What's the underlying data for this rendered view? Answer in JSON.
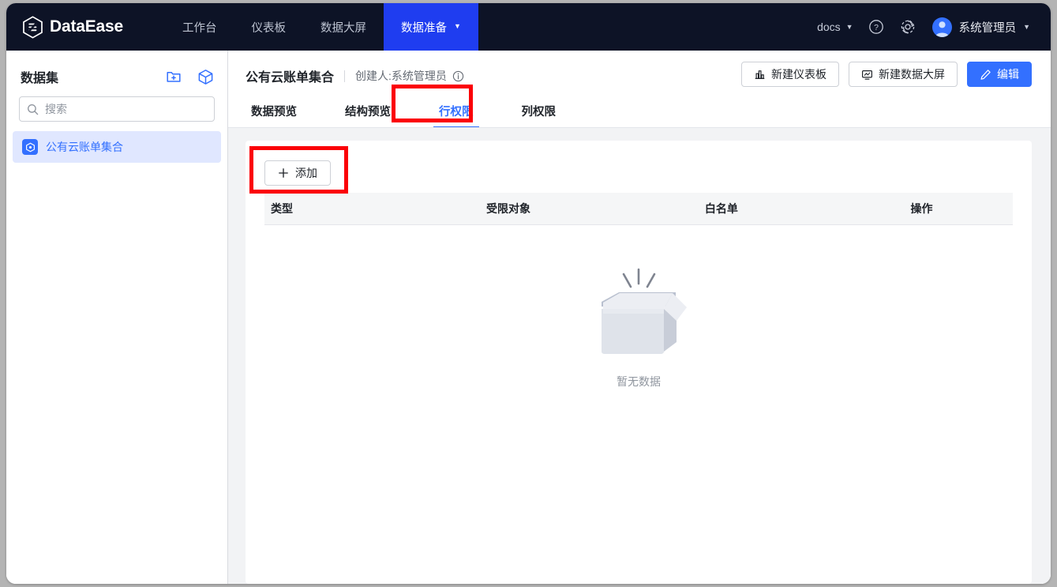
{
  "topbar": {
    "logo_text": "DataEase",
    "logo_icon": "dataease-hexagon-logo",
    "nav": [
      {
        "label": "工作台",
        "active": false,
        "caret": false
      },
      {
        "label": "仪表板",
        "active": false,
        "caret": false
      },
      {
        "label": "数据大屏",
        "active": false,
        "caret": false
      },
      {
        "label": "数据准备",
        "active": true,
        "caret": true
      }
    ],
    "docs_label": "docs",
    "docs_caret": "▼",
    "help_icon": "question-circle-icon",
    "settings_icon": "gear-icon",
    "user_name": "系统管理员",
    "user_caret": "▼",
    "avatar_icon": "user-avatar-icon",
    "active_color": "#1f3df0",
    "bar_color": "#0d1326"
  },
  "sidebar": {
    "title": "数据集",
    "new_folder_icon": "folder-plus-icon",
    "new_dataset_icon": "cube-icon",
    "search": {
      "placeholder": "搜索",
      "value": "",
      "icon": "search-icon"
    },
    "items": [
      {
        "label": "公有云账单集合",
        "icon": "dataset-cube-icon",
        "selected": true
      }
    ],
    "selected_bg": "#e0e7ff",
    "selected_text": "#3370ff"
  },
  "main": {
    "dataset_name": "公有云账单集合",
    "creator_label": "创建人:系统管理员",
    "info_icon": "info-circle-icon",
    "actions": [
      {
        "label": "新建仪表板",
        "icon": "bar-chart-icon",
        "style": "outline"
      },
      {
        "label": "新建数据大屏",
        "icon": "screen-icon",
        "style": "outline"
      },
      {
        "label": "编辑",
        "icon": "pencil-icon",
        "style": "primary"
      }
    ],
    "tabs": [
      {
        "label": "数据预览",
        "active": false
      },
      {
        "label": "结构预览",
        "active": false
      },
      {
        "label": "行权限",
        "active": true
      },
      {
        "label": "列权限",
        "active": false
      }
    ],
    "active_tab_color": "#3370ff"
  },
  "panel": {
    "add_button": {
      "label": "添加",
      "icon": "plus-icon"
    },
    "table": {
      "columns": [
        "类型",
        "受限对象",
        "白名单",
        "操作"
      ],
      "rows": []
    },
    "empty": {
      "label": "暂无数据",
      "illustration": "empty-box-illustration"
    }
  },
  "annotations": {
    "color": "#fb0007",
    "boxes": [
      {
        "target": "行权限",
        "name": "row-permission-tab-highlight"
      },
      {
        "target": "添加",
        "name": "add-button-highlight"
      }
    ]
  }
}
